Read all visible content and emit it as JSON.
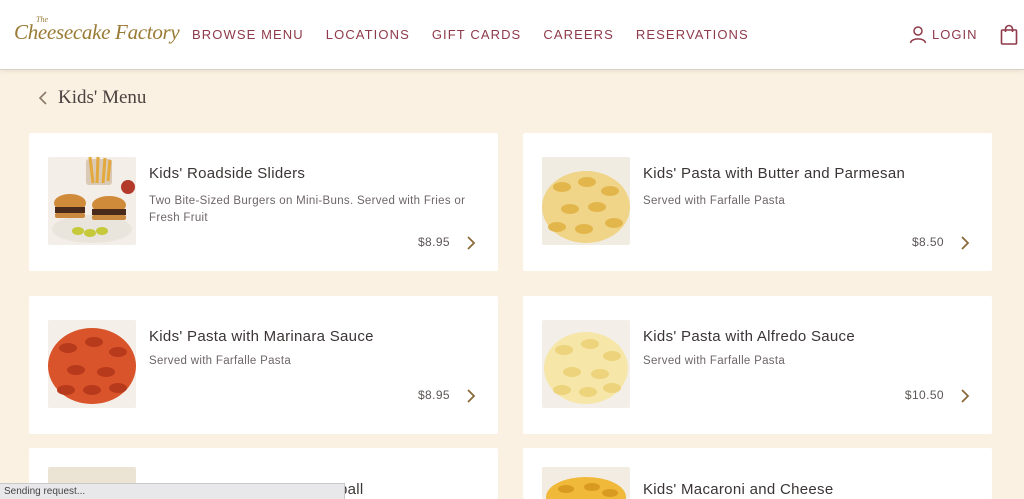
{
  "brand": {
    "the": "The",
    "name": "Cheesecake Factory"
  },
  "nav": [
    "BROWSE MENU",
    "LOCATIONS",
    "GIFT CARDS",
    "CAREERS",
    "RESERVATIONS"
  ],
  "header": {
    "login_label": "LOGIN"
  },
  "page": {
    "title": "Kids' Menu"
  },
  "colors": {
    "brand_gold": "#9a7b36",
    "nav_burgundy": "#8e3a4a",
    "page_bg": "#fbf1e2"
  },
  "items": [
    {
      "name": "Kids' Roadside Sliders",
      "description": "Two Bite-Sized Burgers on Mini-Buns. Served with Fries or Fresh Fruit",
      "price": "$8.95",
      "image": "sliders-photo"
    },
    {
      "name": "Kids' Pasta with Butter and Parmesan",
      "description": "Served with Farfalle Pasta",
      "price": "$8.50",
      "image": "butter-pasta-photo"
    },
    {
      "name": "Kids' Pasta with Marinara Sauce",
      "description": "Served with Farfalle Pasta",
      "price": "$8.95",
      "image": "marinara-pasta-photo"
    },
    {
      "name": "Kids' Pasta with Alfredo Sauce",
      "description": "Served with Farfalle Pasta",
      "price": "$10.50",
      "image": "alfredo-pasta-photo"
    },
    {
      "name": "ball",
      "description": "",
      "price": "",
      "image": "meatball-photo"
    },
    {
      "name": "Kids' Macaroni and Cheese",
      "description": "",
      "price": "",
      "image": "mac-cheese-photo"
    }
  ],
  "status": {
    "text": "Sending request..."
  }
}
